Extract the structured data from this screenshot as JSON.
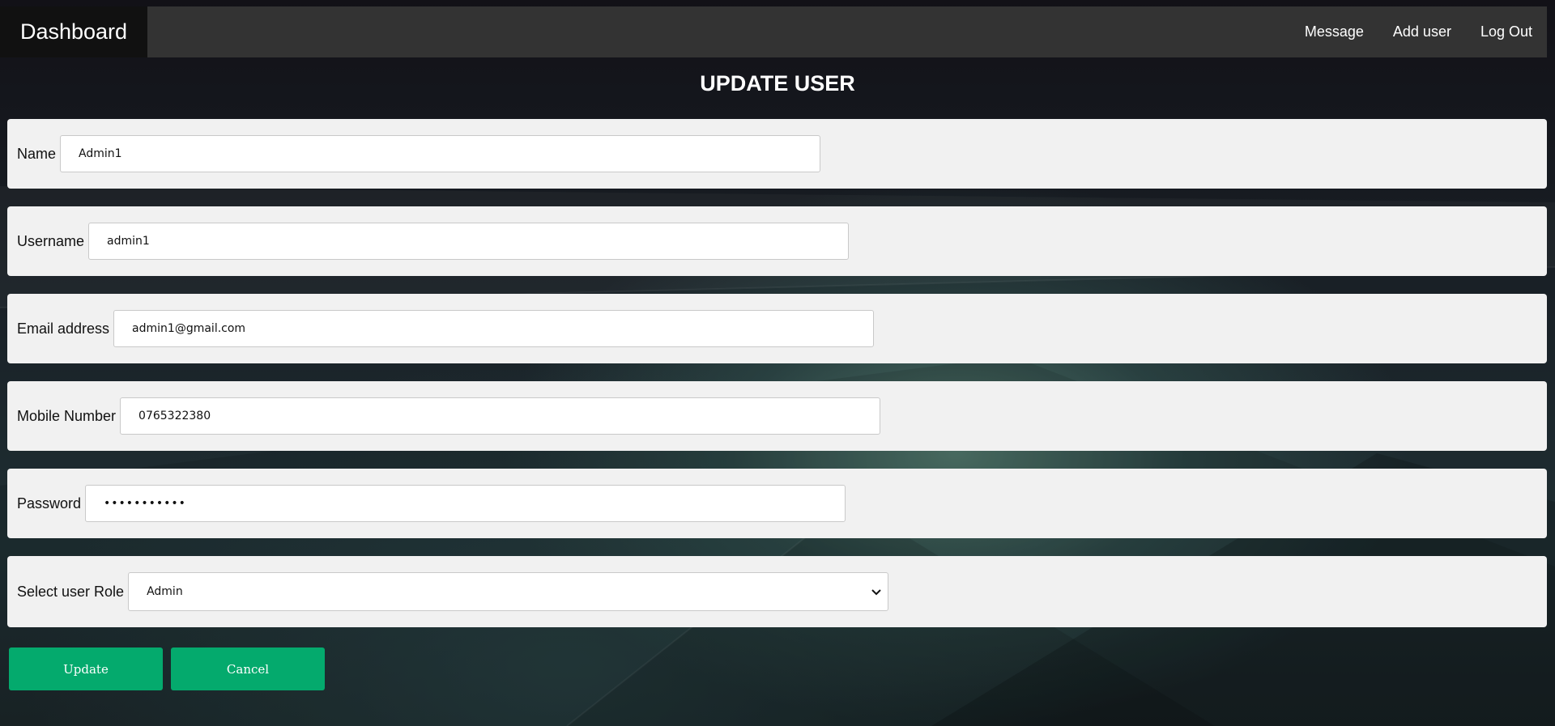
{
  "nav": {
    "brand": "Dashboard",
    "links": [
      "Message",
      "Add user",
      "Log Out"
    ]
  },
  "page": {
    "title": "UPDATE USER"
  },
  "form": {
    "name": {
      "label": "Name",
      "value": "Admin1"
    },
    "username": {
      "label": "Username",
      "value": "admin1"
    },
    "email": {
      "label": "Email address",
      "value": "admin1@gmail.com"
    },
    "mobile": {
      "label": "Mobile Number",
      "value": "0765322380"
    },
    "password": {
      "label": "Password",
      "value": "•••••••••••"
    },
    "role": {
      "label": "Select user Role",
      "selected": "Admin"
    }
  },
  "buttons": {
    "update": "Update",
    "cancel": "Cancel"
  },
  "colors": {
    "navbar": "#333333",
    "brand_bg": "#111111",
    "button": "#04aa6d",
    "row_bg": "#f1f1f1"
  },
  "icons": {
    "select_arrow": "chevron-down-icon"
  }
}
